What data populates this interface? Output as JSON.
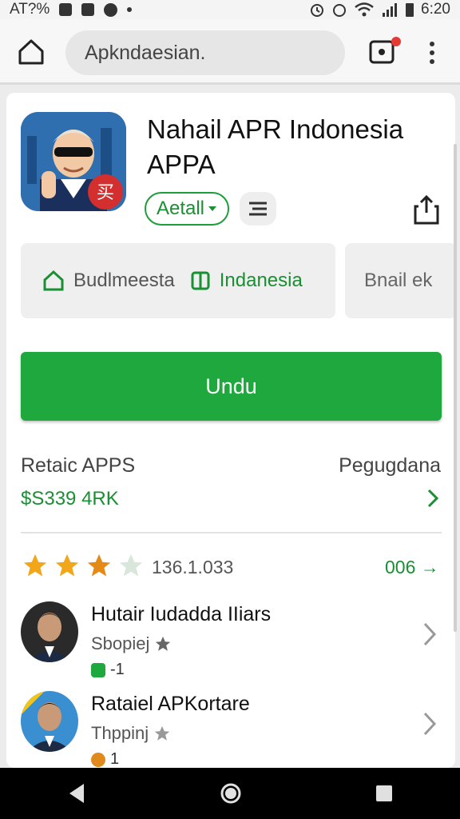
{
  "status_bar": {
    "left_text": "AT?%",
    "time": "6:20"
  },
  "address_bar": {
    "url": "Apkndaesian."
  },
  "app": {
    "title": "Nahail APR Indonesia APPA",
    "detail_label": "Aetall",
    "icon_badge_text": "买"
  },
  "chips": {
    "chip1_left": "Budlmeesta",
    "chip1_right": "Indanesia",
    "chip2": "Bnail ek"
  },
  "install_button": {
    "label": "Undu"
  },
  "info": {
    "left_label": "Retaic APPS",
    "left_value": "$S339 4RK",
    "right_label": "Pegugdana"
  },
  "ratings": {
    "stars_filled": 3,
    "stars_total": 4,
    "count": "136.1.033",
    "link_text": "006 →"
  },
  "reviews": [
    {
      "name": "Hutair Iudadda IIiars",
      "sub": "Sbopiej",
      "meta": "-1"
    },
    {
      "name": "Rataiel APKortare",
      "sub": "Thppinj",
      "meta": "1"
    }
  ],
  "colors": {
    "accent_green": "#1fa83e",
    "star_gold": "#f2a619",
    "star_orange": "#e58a17"
  }
}
